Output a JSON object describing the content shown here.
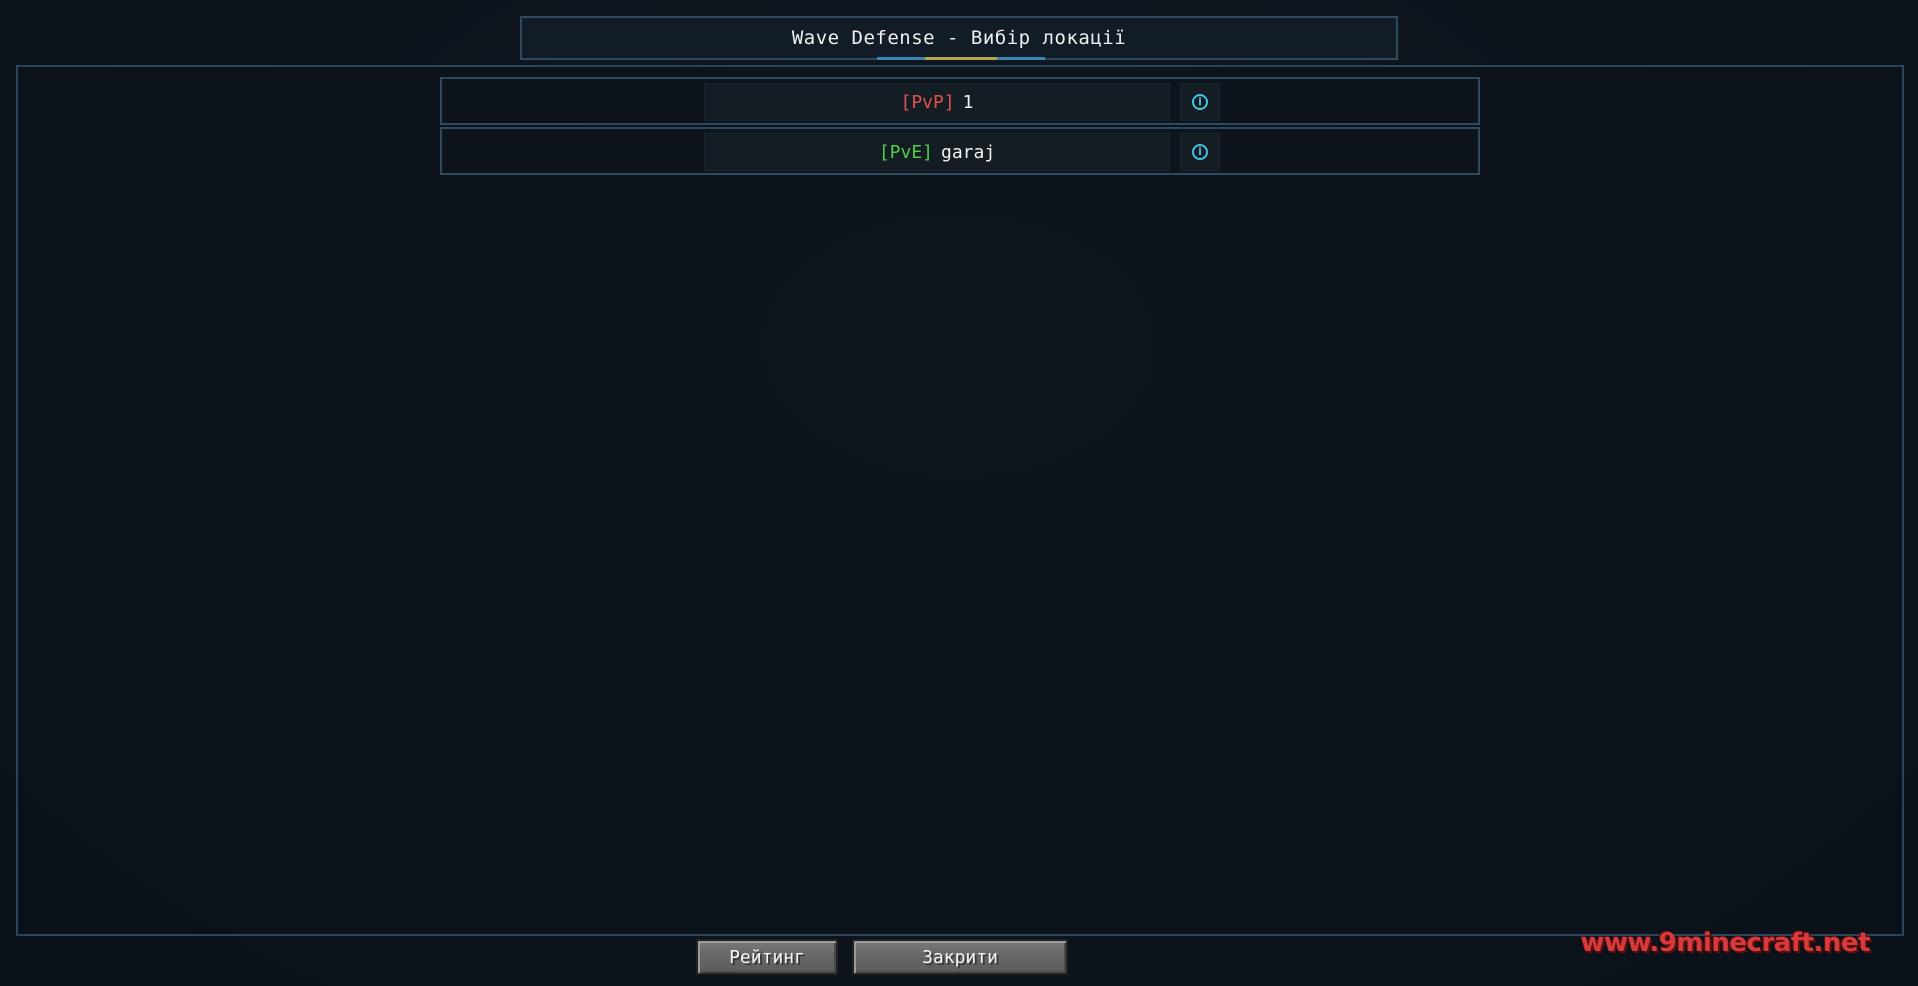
{
  "title": "Wave Defense - Вибір локації",
  "locations": [
    {
      "tag": "[PvP]",
      "tag_color": "#e0514d",
      "name": "1",
      "info_icon": "info-icon"
    },
    {
      "tag": "[PvE]",
      "tag_color": "#4fcf4a",
      "name": "garaj",
      "info_icon": "info-icon"
    }
  ],
  "buttons": {
    "rating_label": "Рейтинг",
    "close_label": "Закрити"
  },
  "watermark": "www.9minecraft.net",
  "colors": {
    "panel_border": "#2f4a5e",
    "background": "#0c121a",
    "info_accent": "#43c4e0"
  }
}
